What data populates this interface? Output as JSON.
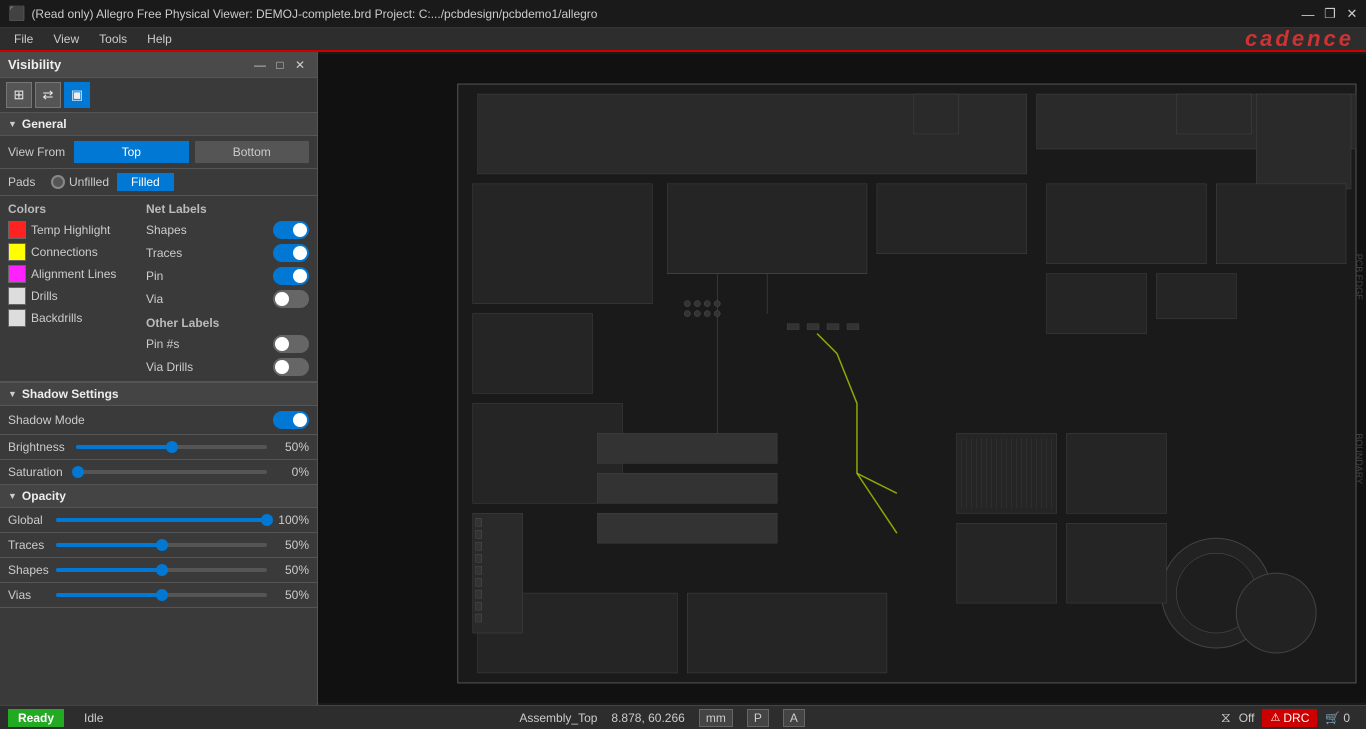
{
  "titlebar": {
    "text": "(Read only) Allegro Free Physical Viewer: DEMOJ-complete.brd  Project: C:.../pcbdesign/pcbdemo1/allegro",
    "minimize": "—",
    "restore": "❐",
    "close": "✕"
  },
  "menubar": {
    "items": [
      "File",
      "View",
      "Tools",
      "Help"
    ],
    "logo": "cadence"
  },
  "panel": {
    "title": "Visibility",
    "minimize": "—",
    "restore": "□",
    "close": "✕",
    "icons": [
      "layers-icon",
      "flip-icon",
      "display-icon"
    ],
    "general": {
      "label": "General",
      "view_from": {
        "label": "View From",
        "top": "Top",
        "bottom": "Bottom",
        "active": "Top"
      },
      "pads": {
        "label": "Pads",
        "unfilled": "Unfilled",
        "filled": "Filled",
        "selected": "Filled"
      }
    },
    "colors": {
      "header": "Colors",
      "items": [
        {
          "label": "Temp Highlight",
          "color": "#ff2222"
        },
        {
          "label": "Connections",
          "color": "#ffff00"
        },
        {
          "label": "Alignment Lines",
          "color": "#ff22ff"
        },
        {
          "label": "Drills",
          "color": "#ffffff"
        },
        {
          "label": "Backdrills",
          "color": "#ffffff"
        }
      ]
    },
    "net_labels": {
      "header": "Net Labels",
      "items": [
        {
          "label": "Shapes",
          "toggle": "on"
        },
        {
          "label": "Traces",
          "toggle": "on"
        },
        {
          "label": "Pin",
          "toggle": "on"
        },
        {
          "label": "Via",
          "toggle": "off"
        }
      ]
    },
    "other_labels": {
      "header": "Other Labels",
      "items": [
        {
          "label": "Pin #s",
          "toggle": "off"
        },
        {
          "label": "Via Drills",
          "toggle": "off"
        }
      ]
    },
    "shadow_settings": {
      "label": "Shadow Settings",
      "shadow_mode": {
        "label": "Shadow Mode",
        "toggle": "on"
      },
      "brightness": {
        "label": "Brightness",
        "value": "50%",
        "percent": 50
      },
      "saturation": {
        "label": "Saturation",
        "value": "0%",
        "percent": 0
      }
    },
    "opacity": {
      "label": "Opacity",
      "global": {
        "label": "Global",
        "value": "100%",
        "percent": 100
      },
      "traces": {
        "label": "Traces",
        "value": "50%",
        "percent": 50
      },
      "shapes": {
        "label": "Shapes",
        "value": "50%",
        "percent": 50
      },
      "vias": {
        "label": "Vias",
        "value": "50%",
        "percent": 50
      }
    }
  },
  "statusbar": {
    "ready": "Ready",
    "idle": "Idle",
    "layer": "Assembly_Top",
    "coords": "8.878, 60.266",
    "unit_mm": "mm",
    "unit_p": "P",
    "unit_a": "A",
    "filter_label": "Off",
    "drc_label": "DRC",
    "cart_label": "0"
  }
}
